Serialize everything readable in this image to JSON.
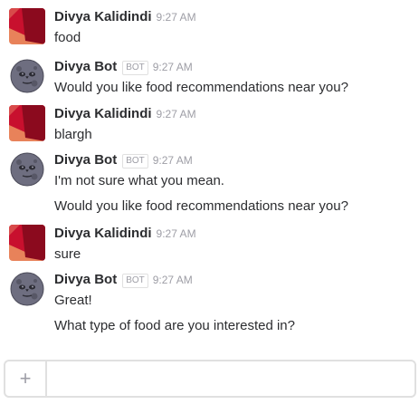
{
  "messages": [
    {
      "sender": "Divya Kalidindi",
      "is_bot": false,
      "time": "9:27 AM",
      "lines": [
        "food"
      ]
    },
    {
      "sender": "Divya Bot",
      "is_bot": true,
      "badge": "BOT",
      "time": "9:27 AM",
      "lines": [
        "Would you like food recommendations near you?"
      ]
    },
    {
      "sender": "Divya Kalidindi",
      "is_bot": false,
      "time": "9:27 AM",
      "lines": [
        "blargh"
      ]
    },
    {
      "sender": "Divya Bot",
      "is_bot": true,
      "badge": "BOT",
      "time": "9:27 AM",
      "lines": [
        "I'm not sure what you mean.",
        "Would you like food recommendations near you?"
      ]
    },
    {
      "sender": "Divya Kalidindi",
      "is_bot": false,
      "time": "9:27 AM",
      "lines": [
        "sure"
      ]
    },
    {
      "sender": "Divya Bot",
      "is_bot": true,
      "badge": "BOT",
      "time": "9:27 AM",
      "lines": [
        "Great!",
        "What type of food are you interested in?"
      ]
    }
  ],
  "composer": {
    "plus_label": "+",
    "value": "",
    "placeholder": ""
  },
  "icons": {
    "user_avatar": "red-geometric-avatar-icon",
    "bot_avatar": "moon-face-avatar-icon",
    "attach": "plus-icon"
  },
  "colors": {
    "text": "#2c2d30",
    "muted": "#9e9ea6",
    "border": "#e0e0e0",
    "avatar_red": "#c8102e",
    "avatar_dark_red": "#8b0a1e",
    "avatar_orange": "#e8825a"
  }
}
